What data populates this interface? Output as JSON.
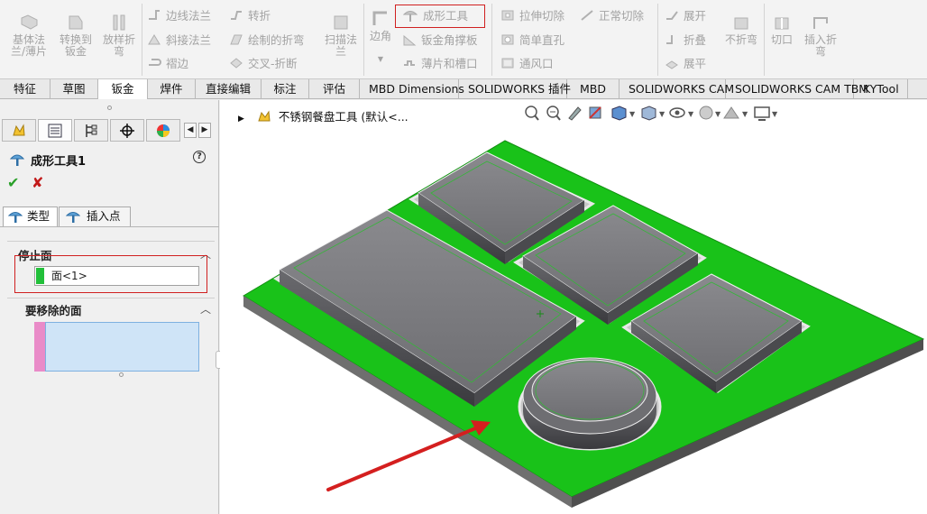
{
  "ribbon": {
    "base_flange": "基体法\n兰/薄片",
    "convert_to_sheet": "转换到\n钣金",
    "lofted_bend": "放样折\n弯",
    "edge_flange": "边线法兰",
    "miter_flange": "斜接法兰",
    "hem": "褶边",
    "jog": "转折",
    "sketched_bend": "绘制的折弯",
    "cross_break": "交叉-折断",
    "swept_flange": "扫描法\n兰",
    "corner": "边角",
    "forming_tool": "成形工具",
    "gusset": "钣金角撑板",
    "tab_and_slot": "薄片和槽口",
    "extruded_cut": "拉伸切除",
    "simple_hole": "简单直孔",
    "vent": "通风口",
    "normal_cut": "正常切除",
    "unfold": "展开",
    "fold": "折叠",
    "flatten": "展平",
    "no_bends": "不折弯",
    "rip": "切口",
    "insert_bends": "插入折\n弯"
  },
  "tabs": [
    "特征",
    "草图",
    "钣金",
    "焊件",
    "直接编辑",
    "标注",
    "评估",
    "MBD Dimensions",
    "SOLIDWORKS 插件",
    "MBD",
    "SOLIDWORKS CAM",
    "SOLIDWORKS CAM TBM",
    "KYTool"
  ],
  "active_tab": "钣金",
  "property_manager": {
    "title": "成形工具1",
    "help": "?",
    "ok": "✔",
    "cancel": "✘",
    "subtab_type": "类型",
    "subtab_insert_point": "插入点",
    "stop_face_header": "停止面",
    "stop_face_value": "面<1>",
    "faces_to_remove_header": "要移除的面"
  },
  "graphics": {
    "tree_root": "不锈钢餐盘工具  (默认<..."
  },
  "colors": {
    "stop_face": "#22c03a",
    "tool_body": "#7c7c80",
    "highlight": "#d02020",
    "list_bg": "#cfe4f7",
    "remove_swatch": "#e98bc8"
  }
}
